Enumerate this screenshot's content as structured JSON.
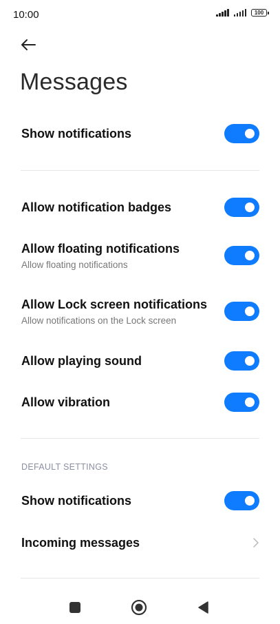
{
  "status_bar": {
    "time": "10:00",
    "battery": "100",
    "icons": [
      "signal-icon",
      "signal-icon",
      "battery-icon"
    ]
  },
  "header": {
    "back_icon": "arrow-left-icon",
    "title": "Messages"
  },
  "settings": {
    "show_notifications": {
      "label": "Show notifications",
      "enabled": true
    },
    "allow_badges": {
      "label": "Allow notification badges",
      "enabled": true
    },
    "allow_floating": {
      "label": "Allow floating notifications",
      "sublabel": "Allow floating notifications",
      "enabled": true
    },
    "allow_lock_screen": {
      "label": "Allow Lock screen notifications",
      "sublabel": "Allow notifications on the Lock screen",
      "enabled": true
    },
    "allow_sound": {
      "label": "Allow playing sound",
      "enabled": true
    },
    "allow_vibration": {
      "label": "Allow vibration",
      "enabled": true
    }
  },
  "default_settings": {
    "header": "DEFAULT SETTINGS",
    "show_notifications": {
      "label": "Show notifications",
      "enabled": true
    },
    "incoming_messages": {
      "label": "Incoming messages"
    }
  },
  "colors": {
    "toggle_on": "#0f7bff",
    "section_header": "#8a8fa3"
  },
  "nav_bar": {
    "icons": [
      "recents-square-icon",
      "home-circle-icon",
      "back-triangle-icon"
    ]
  }
}
